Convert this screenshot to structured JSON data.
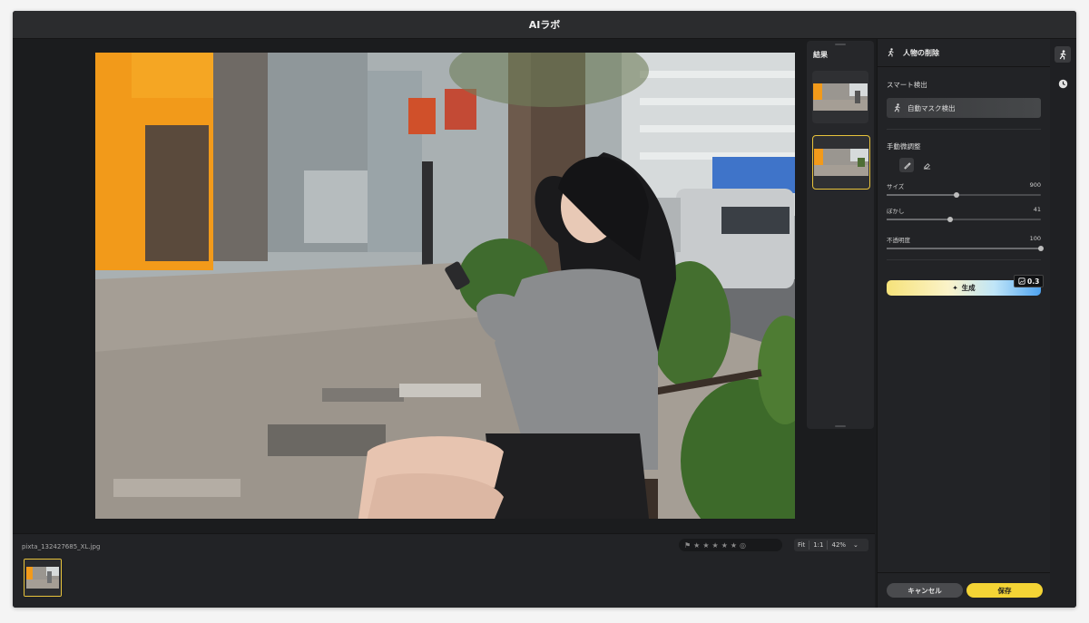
{
  "window": {
    "title": "AIラボ"
  },
  "results": {
    "title": "結果"
  },
  "panel": {
    "header": "人物の削除",
    "smart_detect": {
      "title": "スマート検出",
      "auto_mask_label": "自動マスク検出"
    },
    "manual": {
      "title": "手動微調整",
      "sliders": [
        {
          "label": "サイズ",
          "value": "900",
          "fraction": 0.45
        },
        {
          "label": "ぼかし",
          "value": "41",
          "fraction": 0.41
        },
        {
          "label": "不透明度",
          "value": "100",
          "fraction": 1.0
        }
      ]
    },
    "generate_label": "生成",
    "credit_value": "0.3",
    "cancel_label": "キャンセル",
    "save_label": "保存"
  },
  "filmstrip": {
    "filename": "pixta_132427685_XL.jpg",
    "rating_stars": [
      "★",
      "★",
      "★",
      "★",
      "★"
    ],
    "zoom_fit": "Fit",
    "zoom_one": "1:1",
    "zoom_level": "42%"
  },
  "colors": {
    "accent_yellow": "#f4d435",
    "selection_border": "#e9c43c"
  }
}
